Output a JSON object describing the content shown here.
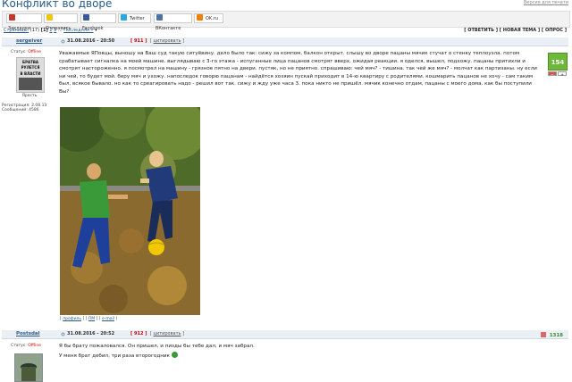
{
  "header": {
    "title": "Конфликт во дворе",
    "top_link": "Версия для печати"
  },
  "share": [
    {
      "label": "Закладки",
      "icon": "bookmarks-icon",
      "color": "#c0392b"
    },
    {
      "label": "Отправить",
      "icon": "mail-icon",
      "color": "#f1c40f"
    },
    {
      "label": "Facebook",
      "icon": "facebook-icon",
      "color": "#3b5998"
    },
    {
      "label": "Twitter",
      "icon": "twitter-icon",
      "color": "#2aa9e0"
    },
    {
      "label": "ВКонтакте",
      "icon": "vk-icon",
      "color": "#4c75a3"
    },
    {
      "label": "OK.ru",
      "icon": "ok-icon",
      "color": "#ee8208"
    }
  ],
  "pager": {
    "label": "Страницы:",
    "count": "(17)",
    "p1": "1",
    "p2": "2",
    "p3": "3",
    "dots": "...",
    "last": "Последняя »",
    "arrow": "▾"
  },
  "actions": {
    "reply": "[ ОТВЕТИТЬ ]",
    "new_topic": "[ НОВАЯ ТЕМА ]",
    "poll": "[ ОПРОС ]"
  },
  "post1": {
    "author": "sergeiver",
    "date": "31.08.2016 - 20:50",
    "number": "[ 911 ]",
    "quote": "цитировать",
    "status_label": "Статус:",
    "status": "Offline",
    "avatar_top": "БРАТВА",
    "avatar_mid": "РУЛЕТСЯ",
    "avatar_bot": "В ВЛАСТИ",
    "avatar_caption": "Ярость",
    "reg": "Регистрация: 2.08.13",
    "messages": "Сообщений: 4586",
    "rating": "154",
    "rating_minus": "−",
    "rating_plus": "+",
    "text": "Уважаемые ЯПовцы, выношу на Ваш суд такую ситуёвину. дело было так: сижу за компом, балкон открыт. слышу во дворе пацаны мячик стучат о стенку теплоузла. потом срабатывает сигналка на моей машине. выглядываю с 3-го этажа - испуганные лица пацанов смотрят вверх, ожидая реакции. я оделся, вышел, подхожу. пацаны притихли и смотрят настороженно. я посмотрел на машину - грязное пятно на двери. пустяк, но не приятно. спрашиваю: чей мяч? - тишина. так чей же мяч? - молчат как партизаны. ну если ни чей, то будет мой. беру мяч и ухожу. напоследок говорю пацанам - найдётся хозяин пускай приходит в 14-ю квартиру с родителями. кошмарить пацанов не хочу - сам таким был, всякое бывало. но как то среагировать надо - решил вот так. сижу и жду уже часа 3. пока никто не пришёл. мячик конечно отдам, пацаны с моего дома. как бы поступили Вы?",
    "footer_profile": "профиль",
    "footer_pm": "ПМ",
    "footer_email": "e-mail"
  },
  "post2": {
    "author": "Postsdal",
    "date": "31.08.2016 - 20:52",
    "number": "[ 912 ]",
    "quote": "цитировать",
    "status_label": "Статус:",
    "status": "Offline",
    "rating": "1318",
    "line1": "Я бы брату пожаловался. Он пришел, и пизды бы тебе дал, и мяч забрал.",
    "line2": "У меня брат дебил, три раза второгодник"
  }
}
